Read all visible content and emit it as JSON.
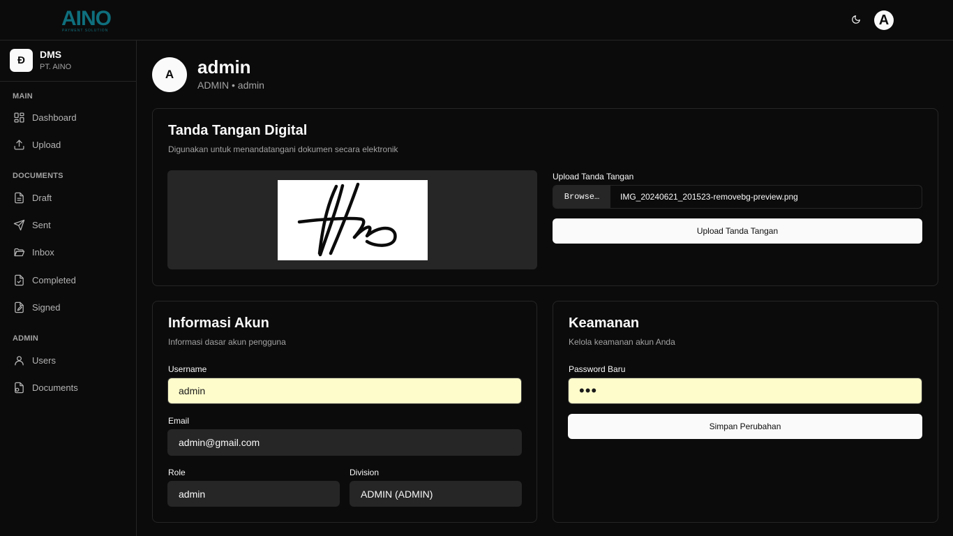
{
  "topbar": {
    "logo_text": "AINO",
    "logo_subtext": "PAYMENT SOLUTION",
    "theme_toggle_icon": "moon-icon",
    "avatar_initial": "A"
  },
  "sidebar": {
    "brand_initial": "Đ",
    "brand_name": "DMS",
    "brand_org": "PT. AINO",
    "sections": {
      "main": "MAIN",
      "documents": "DOCUMENTS",
      "admin": "ADMIN"
    },
    "items": [
      {
        "label": "Dashboard",
        "icon": "dashboard-icon"
      },
      {
        "label": "Upload",
        "icon": "upload-icon"
      },
      {
        "label": "Draft",
        "icon": "file-icon"
      },
      {
        "label": "Sent",
        "icon": "send-icon"
      },
      {
        "label": "Inbox",
        "icon": "folder-open-icon"
      },
      {
        "label": "Completed",
        "icon": "file-check-icon"
      },
      {
        "label": "Signed",
        "icon": "file-signature-icon"
      },
      {
        "label": "Users",
        "icon": "user-icon"
      },
      {
        "label": "Documents",
        "icon": "documents-icon"
      }
    ]
  },
  "profile": {
    "initial": "A",
    "name": "admin",
    "subtitle": "ADMIN • admin"
  },
  "signature_card": {
    "title": "Tanda Tangan Digital",
    "description": "Digunakan untuk menandatangani dokumen secara elektronik",
    "upload_label": "Upload Tanda Tangan",
    "browse_label": "Browse…",
    "file_name": "IMG_20240621_201523-removebg-preview.png",
    "upload_button": "Upload Tanda Tangan"
  },
  "account_card": {
    "title": "Informasi Akun",
    "description": "Informasi dasar akun pengguna",
    "username_label": "Username",
    "username_value": "admin",
    "email_label": "Email",
    "email_value": "admin@gmail.com",
    "role_label": "Role",
    "role_value": "admin",
    "division_label": "Division",
    "division_value": "ADMIN (ADMIN)"
  },
  "security_card": {
    "title": "Keamanan",
    "description": "Kelola keamanan akun Anda",
    "password_label": "Password Baru",
    "password_value": "•••",
    "save_button": "Simpan Perubahan"
  }
}
